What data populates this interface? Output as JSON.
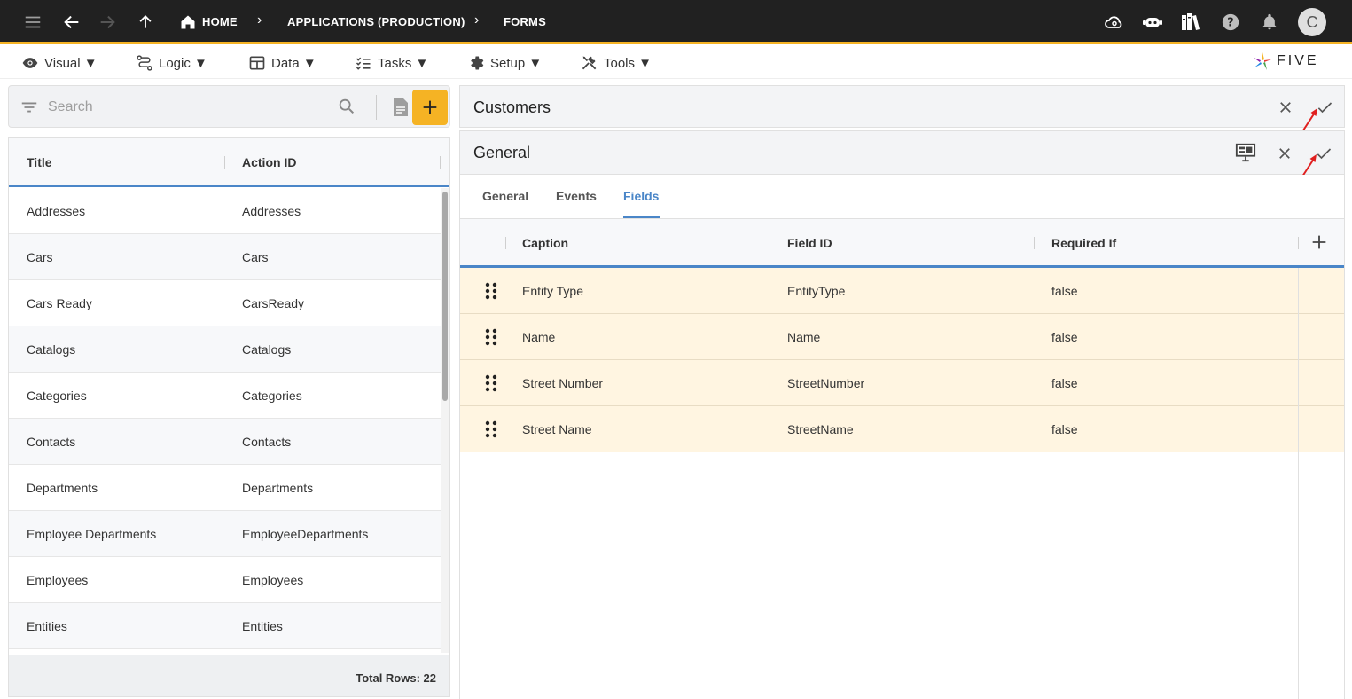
{
  "breadcrumb": {
    "home": "HOME",
    "applications": "APPLICATIONS (PRODUCTION)",
    "forms": "FORMS"
  },
  "user": {
    "initial": "C"
  },
  "menu": {
    "visual": "Visual ▼",
    "logic": "Logic ▼",
    "data": "Data ▼",
    "tasks": "Tasks ▼",
    "setup": "Setup ▼",
    "tools": "Tools ▼"
  },
  "logo": {
    "text": "FIVE"
  },
  "search": {
    "placeholder": "Search"
  },
  "list": {
    "headers": {
      "title": "Title",
      "action_id": "Action ID"
    },
    "rows": [
      {
        "title": "Addresses",
        "action_id": "Addresses"
      },
      {
        "title": "Cars",
        "action_id": "Cars"
      },
      {
        "title": "Cars Ready",
        "action_id": "CarsReady"
      },
      {
        "title": "Catalogs",
        "action_id": "Catalogs"
      },
      {
        "title": "Categories",
        "action_id": "Categories"
      },
      {
        "title": "Contacts",
        "action_id": "Contacts"
      },
      {
        "title": "Departments",
        "action_id": "Departments"
      },
      {
        "title": "Employee Departments",
        "action_id": "EmployeeDepartments"
      },
      {
        "title": "Employees",
        "action_id": "Employees"
      },
      {
        "title": "Entities",
        "action_id": "Entities"
      }
    ],
    "total": "Total Rows: 22"
  },
  "customers_panel": {
    "title": "Customers"
  },
  "general_panel": {
    "title": "General"
  },
  "tabs": {
    "general": "General",
    "events": "Events",
    "fields": "Fields"
  },
  "fields": {
    "headers": {
      "caption": "Caption",
      "field_id": "Field ID",
      "required_if": "Required If"
    },
    "rows": [
      {
        "caption": "Entity Type",
        "field_id": "EntityType",
        "required_if": "false"
      },
      {
        "caption": "Name",
        "field_id": "Name",
        "required_if": "false"
      },
      {
        "caption": "Street Number",
        "field_id": "StreetNumber",
        "required_if": "false"
      },
      {
        "caption": "Street Name",
        "field_id": "StreetName",
        "required_if": "false"
      }
    ]
  },
  "colors": {
    "accent": "#f5b324",
    "link": "#4a86c8",
    "row_highlight": "#fff5e1",
    "topbar": "#212121",
    "annotation_arrow": "#e02020"
  }
}
